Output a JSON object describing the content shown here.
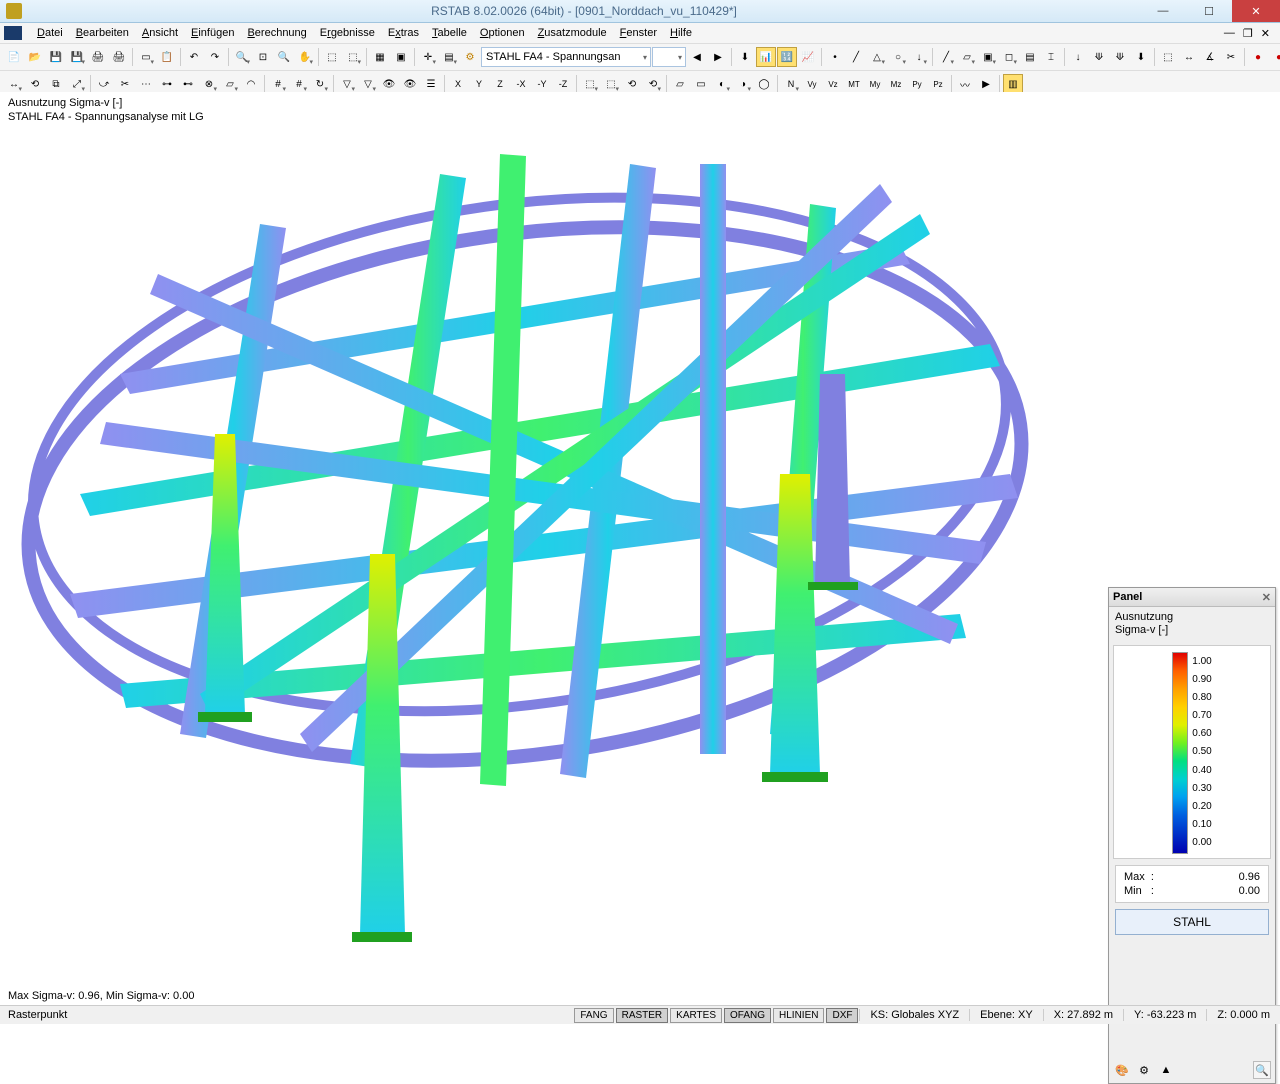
{
  "title": "RSTAB 8.02.0026 (64bit) - [0901_Norddach_vu_110429*]",
  "menu": {
    "datei": "Datei",
    "bearbeiten": "Bearbeiten",
    "ansicht": "Ansicht",
    "einfuegen": "Einfügen",
    "berechnung": "Berechnung",
    "ergebnisse": "Ergebnisse",
    "extras": "Extras",
    "tabelle": "Tabelle",
    "optionen": "Optionen",
    "zusatzmodule": "Zusatzmodule",
    "fenster": "Fenster",
    "hilfe": "Hilfe"
  },
  "toolbar": {
    "combo1": "STAHL FA4 - Spannungsan",
    "combo2": ""
  },
  "viewport": {
    "line1": "Ausnutzung Sigma-v [-]",
    "line2": "STAHL FA4 - Spannungsanalyse mit LG",
    "bottom": "Max Sigma-v: 0.96, Min Sigma-v: 0.00"
  },
  "panel": {
    "title": "Panel",
    "sub1": "Ausnutzung",
    "sub2": "Sigma-v [-]",
    "scale": [
      "1.00",
      "0.90",
      "0.80",
      "0.70",
      "0.60",
      "0.50",
      "0.40",
      "0.30",
      "0.20",
      "0.10",
      "0.00"
    ],
    "max_label": "Max",
    "max_val": "0.96",
    "min_label": "Min",
    "min_val": "0.00",
    "button": "STAHL"
  },
  "status": {
    "left": "Rasterpunkt",
    "btns": {
      "fang": "FANG",
      "raster": "RASTER",
      "kartes": "KARTES",
      "ofang": "OFANG",
      "hlinien": "HLINIEN",
      "dxf": "DXF"
    },
    "ks": "KS: Globales XYZ",
    "ebene": "Ebene: XY",
    "x": "X:  27.892 m",
    "y": "Y:  -63.223 m",
    "z": "Z:  0.000 m"
  },
  "chart_data": {
    "type": "heatmap",
    "title": "Ausnutzung Sigma-v [-]",
    "subtitle": "STAHL FA4 - Spannungsanalyse mit LG",
    "color_scale_label": "Ausnutzung Sigma-v [-]",
    "color_scale_range": [
      0.0,
      1.0
    ],
    "color_scale_ticks": [
      0.0,
      0.1,
      0.2,
      0.3,
      0.4,
      0.5,
      0.6,
      0.7,
      0.8,
      0.9,
      1.0
    ],
    "color_scale_colors": [
      "#0000b0",
      "#0060e0",
      "#00a0f0",
      "#00d0d0",
      "#00e080",
      "#70f020",
      "#e0f000",
      "#ffd000",
      "#ffa000",
      "#ff6000",
      "#e00000"
    ],
    "summary": {
      "max": 0.96,
      "min": 0.0
    },
    "description": "3D structural model (elliptical roof truss with 4 tapered columns) colored by von-Mises stress utilization ratio."
  }
}
